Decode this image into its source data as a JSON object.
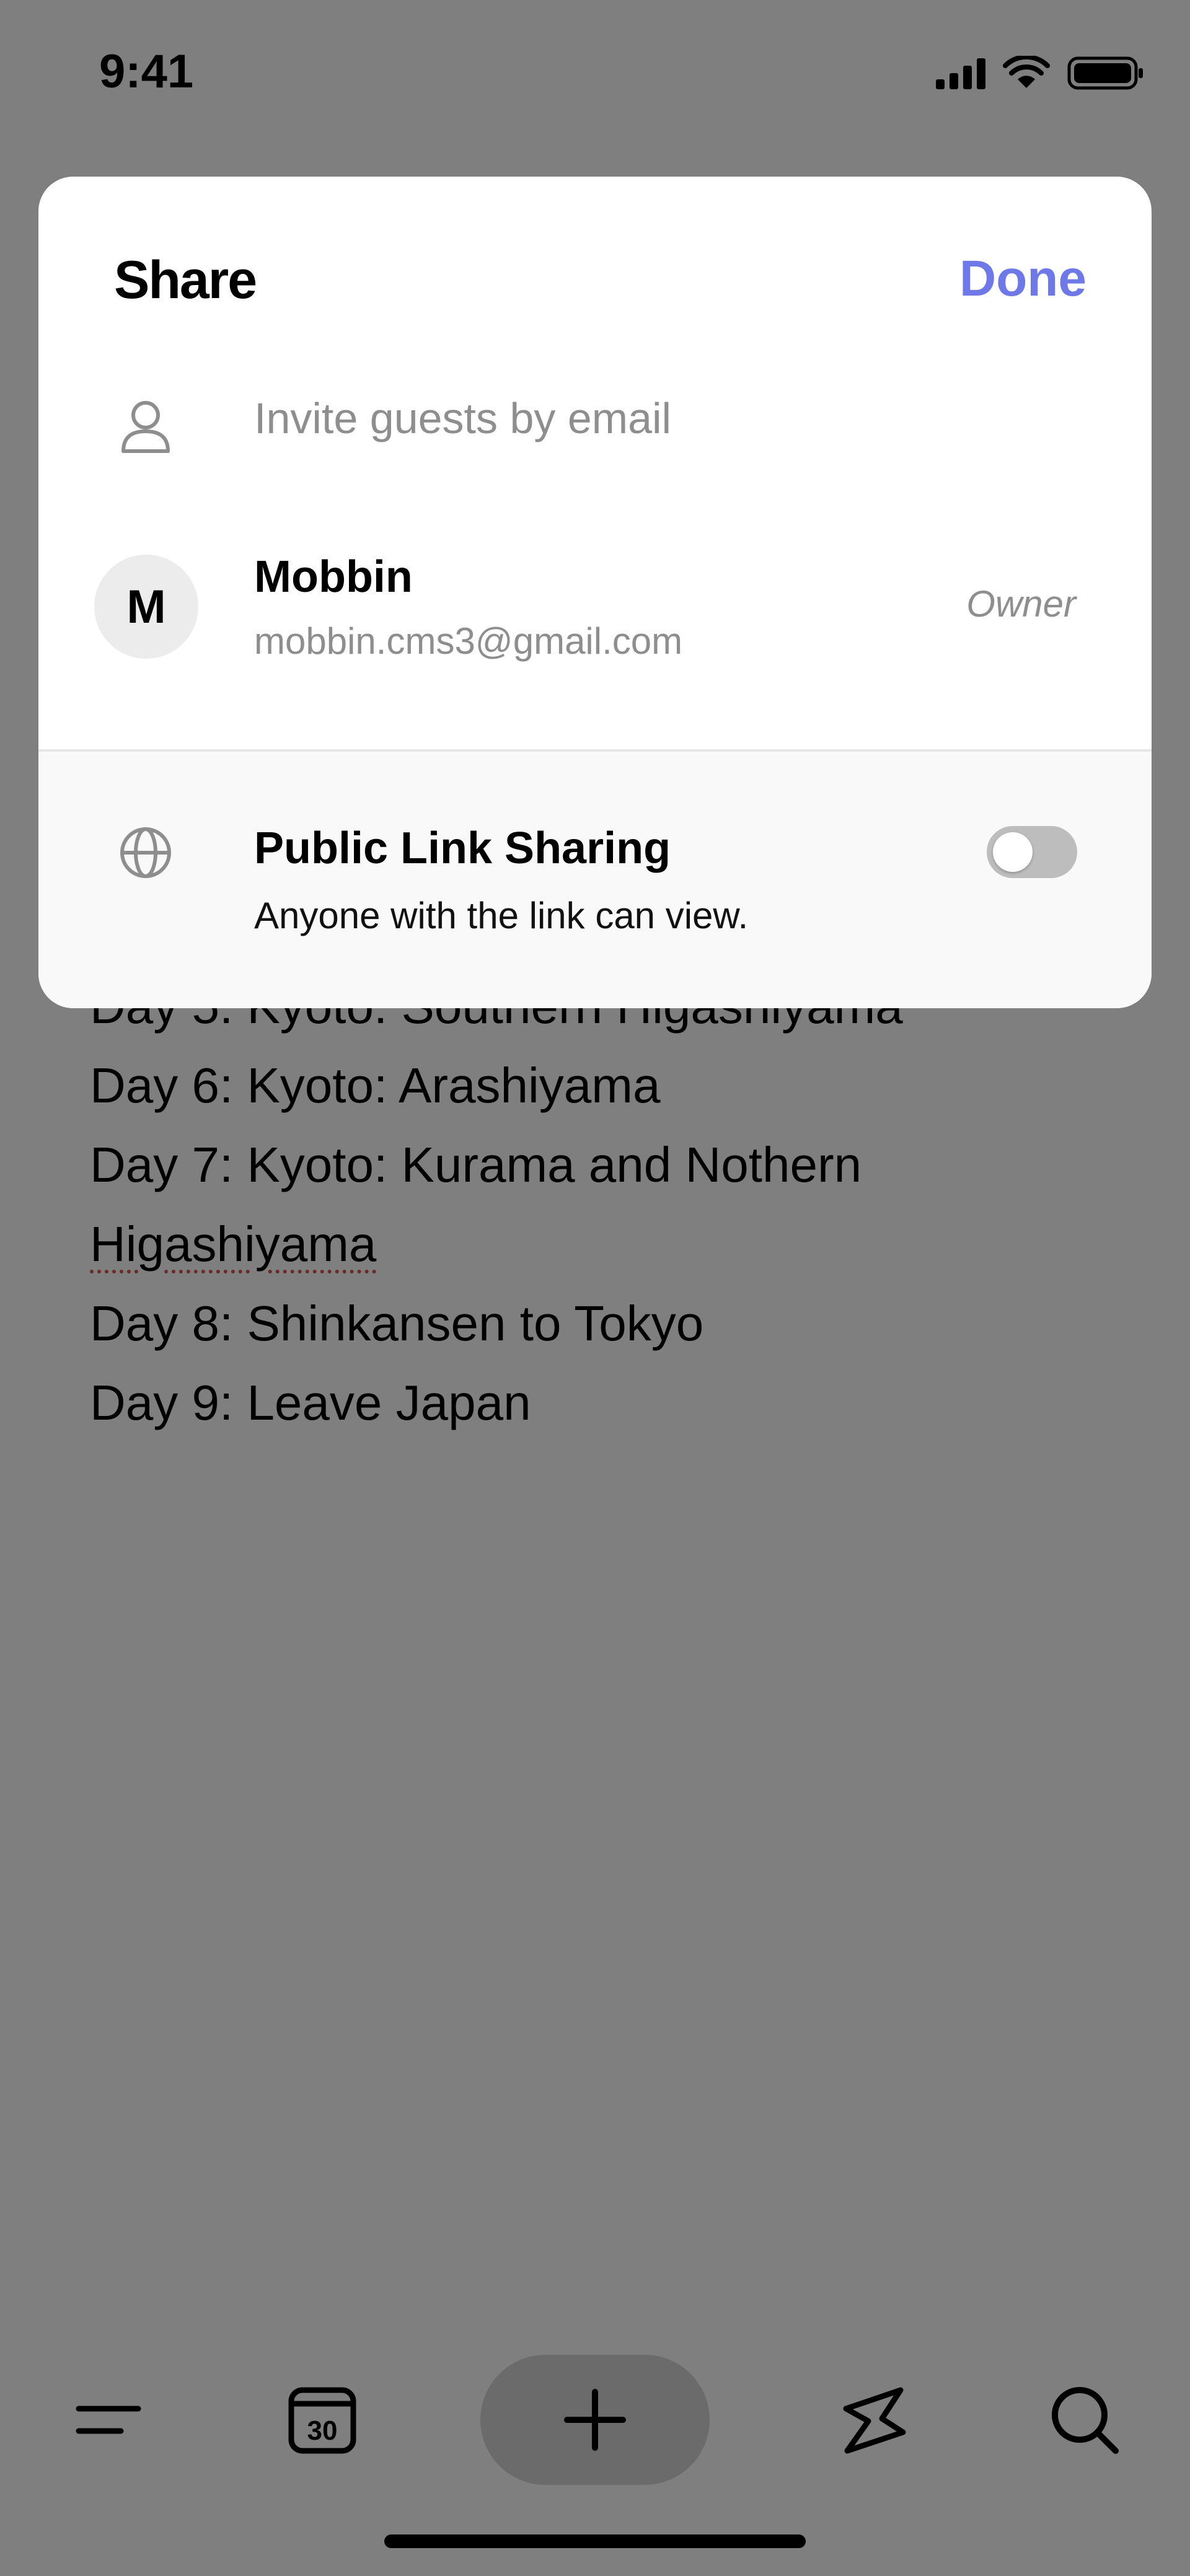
{
  "status_bar": {
    "time": "9:41"
  },
  "note": {
    "lines": [
      {
        "text": "Day 5: Kyoto: Southern Higashiyama",
        "partial": true
      },
      {
        "text": "Day 6: Kyoto: Arashiyama"
      },
      {
        "text": "Day 7: Kyoto: Kurama and Nothern"
      },
      {
        "text": "Higashiyama"
      },
      {
        "text": "Day 8: Shinkansen to Tokyo"
      },
      {
        "text": "Day 9: Leave Japan"
      }
    ]
  },
  "share_sheet": {
    "title": "Share",
    "done_label": "Done",
    "invite_placeholder": "Invite guests by email",
    "member": {
      "initial": "M",
      "name": "Mobbin",
      "email": "mobbin.cms3@gmail.com",
      "role": "Owner"
    },
    "public_link": {
      "title": "Public Link Sharing",
      "description": "Anyone with the link can view.",
      "enabled": false
    }
  },
  "toolbar": {
    "items": [
      {
        "icon": "menu-icon"
      },
      {
        "icon": "calendar-icon",
        "label": "30"
      },
      {
        "icon": "plus-icon"
      },
      {
        "icon": "lightning-icon"
      },
      {
        "icon": "search-icon"
      }
    ]
  },
  "colors": {
    "accent": "#6e78e6",
    "overlay": "rgba(0,0,0,0.5)",
    "muted_text": "#8e8e8e",
    "toggle_off": "#bdbdbd"
  }
}
